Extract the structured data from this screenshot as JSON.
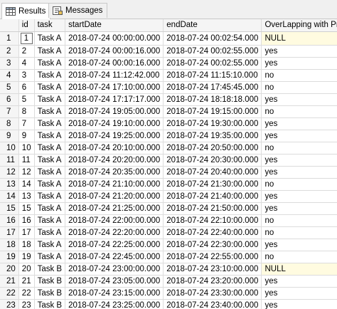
{
  "tabs": [
    {
      "label": "Results",
      "active": true,
      "icon": "grid-icon"
    },
    {
      "label": "Messages",
      "active": false,
      "icon": "messages-icon"
    }
  ],
  "columns": [
    "id",
    "task",
    "startDate",
    "endDate",
    "OverLapping with Previous"
  ],
  "rows": [
    {
      "n": "1",
      "id": "1",
      "task": "Task A",
      "start": "2018-07-24 00:00:00.000",
      "end": "2018-07-24 00:02:54.000",
      "overlap": "NULL"
    },
    {
      "n": "2",
      "id": "2",
      "task": "Task A",
      "start": "2018-07-24 00:00:16.000",
      "end": "2018-07-24 00:02:55.000",
      "overlap": "yes"
    },
    {
      "n": "3",
      "id": "4",
      "task": "Task A",
      "start": "2018-07-24 00:00:16.000",
      "end": "2018-07-24 00:02:55.000",
      "overlap": "yes"
    },
    {
      "n": "4",
      "id": "3",
      "task": "Task A",
      "start": "2018-07-24 11:12:42.000",
      "end": "2018-07-24 11:15:10.000",
      "overlap": "no"
    },
    {
      "n": "5",
      "id": "6",
      "task": "Task A",
      "start": "2018-07-24 17:10:00.000",
      "end": "2018-07-24 17:45:45.000",
      "overlap": "no"
    },
    {
      "n": "6",
      "id": "5",
      "task": "Task A",
      "start": "2018-07-24 17:17:17.000",
      "end": "2018-07-24 18:18:18.000",
      "overlap": "yes"
    },
    {
      "n": "7",
      "id": "8",
      "task": "Task A",
      "start": "2018-07-24 19:05:00.000",
      "end": "2018-07-24 19:15:00.000",
      "overlap": "no"
    },
    {
      "n": "8",
      "id": "7",
      "task": "Task A",
      "start": "2018-07-24 19:10:00.000",
      "end": "2018-07-24 19:30:00.000",
      "overlap": "yes"
    },
    {
      "n": "9",
      "id": "9",
      "task": "Task A",
      "start": "2018-07-24 19:25:00.000",
      "end": "2018-07-24 19:35:00.000",
      "overlap": "yes"
    },
    {
      "n": "10",
      "id": "10",
      "task": "Task A",
      "start": "2018-07-24 20:10:00.000",
      "end": "2018-07-24 20:50:00.000",
      "overlap": "no"
    },
    {
      "n": "11",
      "id": "11",
      "task": "Task A",
      "start": "2018-07-24 20:20:00.000",
      "end": "2018-07-24 20:30:00.000",
      "overlap": "yes"
    },
    {
      "n": "12",
      "id": "12",
      "task": "Task A",
      "start": "2018-07-24 20:35:00.000",
      "end": "2018-07-24 20:40:00.000",
      "overlap": "yes"
    },
    {
      "n": "13",
      "id": "14",
      "task": "Task A",
      "start": "2018-07-24 21:10:00.000",
      "end": "2018-07-24 21:30:00.000",
      "overlap": "no"
    },
    {
      "n": "14",
      "id": "13",
      "task": "Task A",
      "start": "2018-07-24 21:20:00.000",
      "end": "2018-07-24 21:40:00.000",
      "overlap": "yes"
    },
    {
      "n": "15",
      "id": "15",
      "task": "Task A",
      "start": "2018-07-24 21:25:00.000",
      "end": "2018-07-24 21:50:00.000",
      "overlap": "yes"
    },
    {
      "n": "16",
      "id": "16",
      "task": "Task A",
      "start": "2018-07-24 22:00:00.000",
      "end": "2018-07-24 22:10:00.000",
      "overlap": "no"
    },
    {
      "n": "17",
      "id": "17",
      "task": "Task A",
      "start": "2018-07-24 22:20:00.000",
      "end": "2018-07-24 22:40:00.000",
      "overlap": "no"
    },
    {
      "n": "18",
      "id": "18",
      "task": "Task A",
      "start": "2018-07-24 22:25:00.000",
      "end": "2018-07-24 22:30:00.000",
      "overlap": "yes"
    },
    {
      "n": "19",
      "id": "19",
      "task": "Task A",
      "start": "2018-07-24 22:45:00.000",
      "end": "2018-07-24 22:55:00.000",
      "overlap": "no"
    },
    {
      "n": "20",
      "id": "20",
      "task": "Task B",
      "start": "2018-07-24 23:00:00.000",
      "end": "2018-07-24 23:10:00.000",
      "overlap": "NULL"
    },
    {
      "n": "21",
      "id": "21",
      "task": "Task B",
      "start": "2018-07-24 23:05:00.000",
      "end": "2018-07-24 23:20:00.000",
      "overlap": "yes"
    },
    {
      "n": "22",
      "id": "22",
      "task": "Task B",
      "start": "2018-07-24 23:15:00.000",
      "end": "2018-07-24 23:30:00.000",
      "overlap": "yes"
    },
    {
      "n": "23",
      "id": "23",
      "task": "Task B",
      "start": "2018-07-24 23:25:00.000",
      "end": "2018-07-24 23:40:00.000",
      "overlap": "yes"
    }
  ],
  "null_highlight_color": "#fffbe0"
}
